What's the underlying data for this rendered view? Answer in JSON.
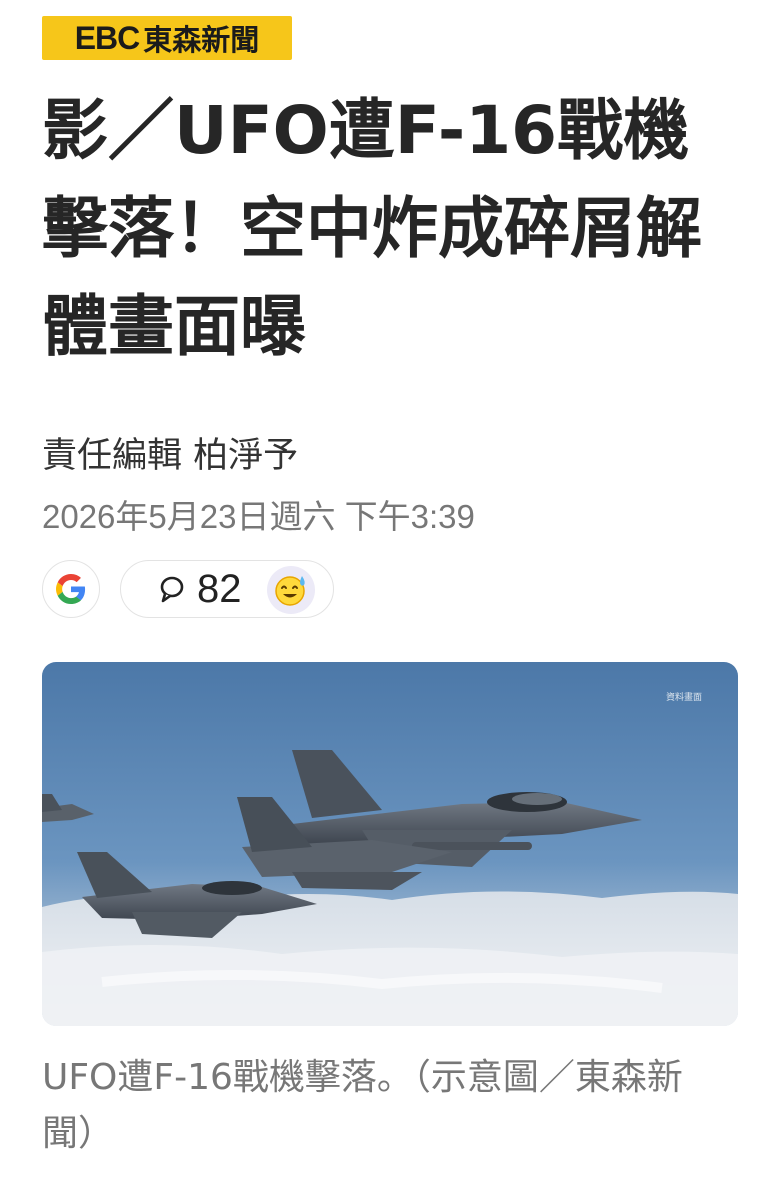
{
  "brand": {
    "logo_latin": "EBC",
    "logo_cjk": "東森新聞",
    "logo_color": "#f6c61a"
  },
  "article": {
    "headline": "影／UFO遭F-16戰機擊落！空中炸成碎屑解體畫面曝",
    "editor": "責任編輯 柏淨予",
    "date": "2026年5月23日週六 下午3:39"
  },
  "actions": {
    "google_icon": "google-icon",
    "comment_icon": "comment-bubble-icon",
    "comment_count": "82",
    "reaction_icon": "sweat-smile-emoji-icon"
  },
  "image": {
    "watermark": "資料畫面",
    "caption": "UFO遭F-16戰機擊落。（示意圖／東森新聞）",
    "sky_color": "#5d87b4",
    "cloud_color": "#e9edf1"
  }
}
